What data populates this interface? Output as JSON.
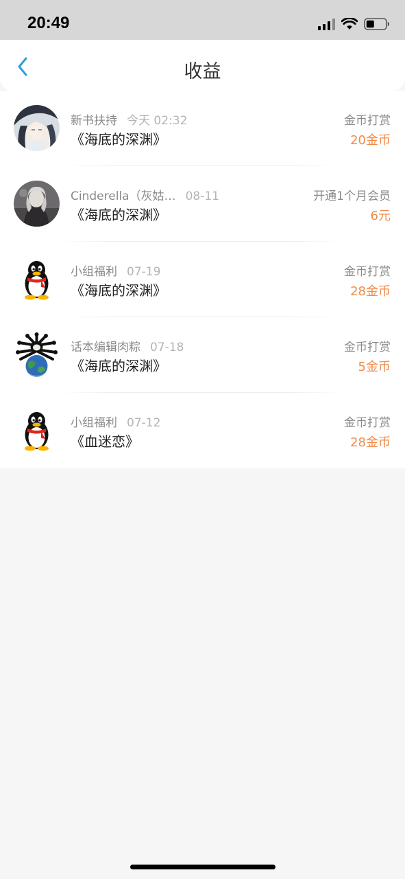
{
  "status_bar": {
    "time": "20:49"
  },
  "header": {
    "title": "收益"
  },
  "items": [
    {
      "name": "新书扶持",
      "date": "今天 02:32",
      "book": "《海底的深渊》",
      "type": "金币打赏",
      "amount": "20金币",
      "avatar": "anime-portrait-avatar"
    },
    {
      "name": "Cinderella（灰姑…",
      "date": "08-11",
      "book": "《海底的深渊》",
      "type": "开通1个月会员",
      "amount": "6元",
      "avatar": "photo-portrait-avatar"
    },
    {
      "name": "小组福利",
      "date": "07-19",
      "book": "《海底的深渊》",
      "type": "金币打赏",
      "amount": "28金币",
      "avatar": "qq-penguin-avatar"
    },
    {
      "name": "话本编辑肉粽",
      "date": "07-18",
      "book": "《海底的深渊》",
      "type": "金币打赏",
      "amount": "5金币",
      "avatar": "earth-bones-avatar"
    },
    {
      "name": "小组福利",
      "date": "07-12",
      "book": "《血迷恋》",
      "type": "金币打赏",
      "amount": "28金币",
      "avatar": "qq-penguin-avatar"
    }
  ],
  "colors": {
    "amount": "#f08a48",
    "back_arrow": "#2a9de0"
  }
}
